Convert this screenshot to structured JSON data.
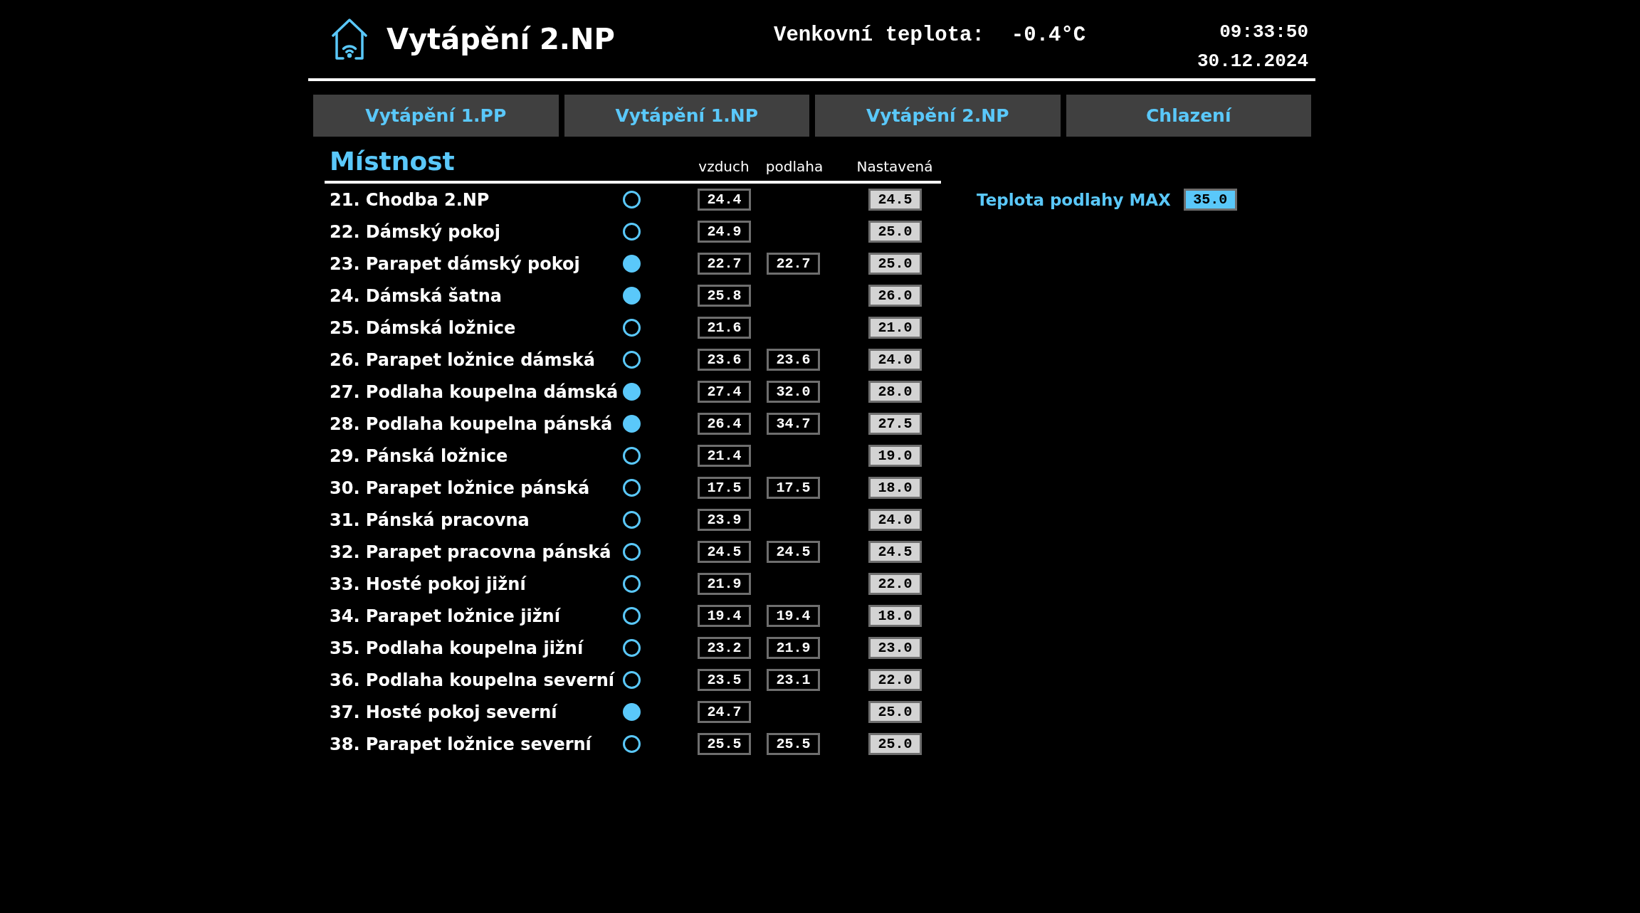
{
  "header": {
    "title": "Vytápění 2.NP",
    "outdoor_label": "Venkovní teplota:",
    "outdoor_value": "-0.4°C",
    "time": "09:33:50",
    "date": "30.12.2024"
  },
  "tabs": [
    {
      "label": "Vytápění 1.PP"
    },
    {
      "label": "Vytápění 1.NP"
    },
    {
      "label": "Vytápění 2.NP"
    },
    {
      "label": "Chlazení"
    }
  ],
  "rooms": {
    "heading": "Místnost",
    "columns": [
      "vzduch",
      "podlaha",
      "Nastavená"
    ],
    "rows": [
      {
        "name": "21. Chodba 2.NP",
        "on": false,
        "air": "24.4",
        "setpoint": "24.5"
      },
      {
        "name": "22. Dámský pokoj",
        "on": false,
        "air": "24.9",
        "setpoint": "25.0"
      },
      {
        "name": "23. Parapet dámský pokoj",
        "on": true,
        "air": "22.7",
        "floor": "22.7",
        "setpoint": "25.0"
      },
      {
        "name": "24. Dámská šatna",
        "on": true,
        "air": "25.8",
        "setpoint": "26.0"
      },
      {
        "name": "25. Dámská ložnice",
        "on": false,
        "air": "21.6",
        "setpoint": "21.0"
      },
      {
        "name": "26. Parapet ložnice dámská",
        "on": false,
        "air": "23.6",
        "floor": "23.6",
        "setpoint": "24.0"
      },
      {
        "name": "27. Podlaha koupelna dámská",
        "on": true,
        "air": "27.4",
        "floor": "32.0",
        "setpoint": "28.0"
      },
      {
        "name": "28. Podlaha koupelna pánská",
        "on": true,
        "air": "26.4",
        "floor": "34.7",
        "setpoint": "27.5"
      },
      {
        "name": "29. Pánská ložnice",
        "on": false,
        "air": "21.4",
        "setpoint": "19.0"
      },
      {
        "name": "30. Parapet ložnice pánská",
        "on": false,
        "air": "17.5",
        "floor": "17.5",
        "setpoint": "18.0"
      },
      {
        "name": "31. Pánská pracovna",
        "on": false,
        "air": "23.9",
        "setpoint": "24.0"
      },
      {
        "name": "32. Parapet pracovna pánská",
        "on": false,
        "air": "24.5",
        "floor": "24.5",
        "setpoint": "24.5"
      },
      {
        "name": "33. Hosté pokoj jižní",
        "on": false,
        "air": "21.9",
        "setpoint": "22.0"
      },
      {
        "name": "34. Parapet ložnice jižní",
        "on": false,
        "air": "19.4",
        "floor": "19.4",
        "setpoint": "18.0"
      },
      {
        "name": "35. Podlaha koupelna jižní",
        "on": false,
        "air": "23.2",
        "floor": "21.9",
        "setpoint": "23.0"
      },
      {
        "name": "36. Podlaha koupelna severní",
        "on": false,
        "air": "23.5",
        "floor": "23.1",
        "setpoint": "22.0"
      },
      {
        "name": "37. Hosté pokoj severní",
        "on": true,
        "air": "24.7",
        "setpoint": "25.0"
      },
      {
        "name": "38. Parapet ložnice severní",
        "on": false,
        "air": "25.5",
        "floor": "25.5",
        "setpoint": "25.0"
      }
    ]
  },
  "floor_limit": {
    "label": "Teplota podlahy MAX",
    "value": "35.0"
  }
}
